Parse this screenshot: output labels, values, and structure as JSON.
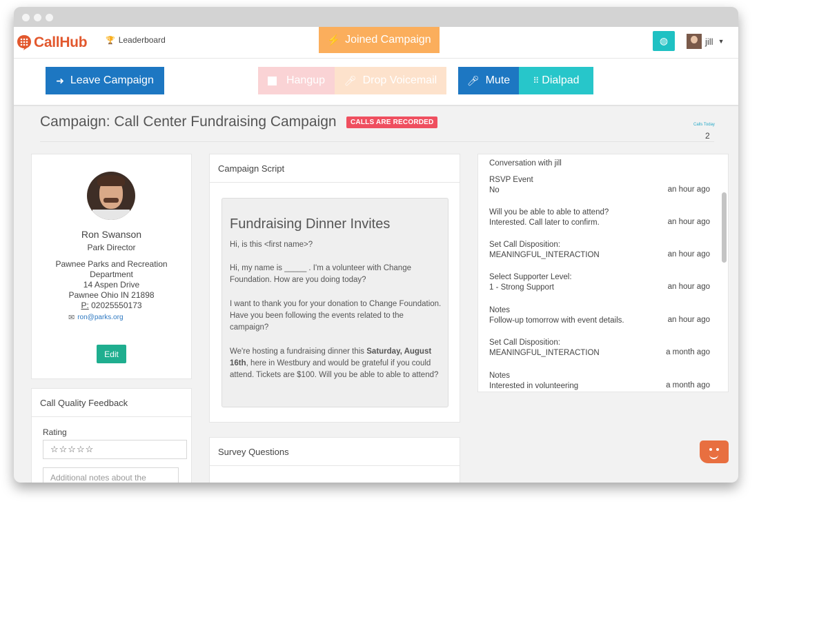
{
  "navbar": {
    "brand": "CallHub",
    "leaderboard": "Leaderboard",
    "joined_campaign": "Joined Campaign",
    "user_name": "jill"
  },
  "toolbar": {
    "leave_campaign": "Leave Campaign",
    "hangup": "Hangup",
    "drop_voicemail": "Drop Voicemail",
    "mute": "Mute",
    "dialpad": "Dialpad"
  },
  "header": {
    "title": "Campaign: Call Center Fundraising Campaign",
    "recorded_badge": "CALLS ARE RECORDED",
    "calls_today_label": "Calls Today",
    "calls_today_value": "2"
  },
  "contact": {
    "name": "Ron Swanson",
    "title": "Park Director",
    "org_line1": "Pawnee Parks and Recreation",
    "org_line2": "Department",
    "street": "14 Aspen Drive",
    "city": "Pawnee Ohio IN 21898",
    "phone_prefix": "P:",
    "phone": "02025550173",
    "email": "ron@parks.org",
    "edit_label": "Edit"
  },
  "feedback": {
    "title": "Call Quality Feedback",
    "rating_label": "Rating",
    "stars": "☆☆☆☆☆",
    "notes_placeholder": "Additional notes about the"
  },
  "script": {
    "panel_title": "Campaign Script",
    "title": "Fundraising Dinner Invites",
    "p1": "Hi, is this <first name>?",
    "p2": "Hi, my name is _____ . I'm a volunteer with Change Foundation. How are you doing today?",
    "p3": "I want to thank you for your donation to Change Foundation. Have you been following the events related to the campaign?",
    "p4_a": "We're hosting a fundraising dinner this ",
    "p4_bold": "Saturday, August 16th",
    "p4_b": ", here in Westbury and would be grateful if you could attend. Tickets are $100. Will you be able to able to attend?"
  },
  "survey": {
    "title": "Survey Questions"
  },
  "conversation": {
    "title": "Conversation with jill",
    "items": [
      {
        "label": "RSVP Event",
        "value": "No",
        "time": "an hour ago"
      },
      {
        "label": "Will you be able to able to attend?",
        "value": "Interested. Call later to confirm.",
        "time": "an hour ago"
      },
      {
        "label": "Set Call Disposition:",
        "value": "MEANINGFUL_INTERACTION",
        "time": "an hour ago"
      },
      {
        "label": "Select Supporter Level:",
        "value": "1 - Strong Support",
        "time": "an hour ago"
      },
      {
        "label": "Notes",
        "value": "Follow-up tomorrow with event details.",
        "time": "an hour ago"
      },
      {
        "label": "Set Call Disposition:",
        "value": "MEANINGFUL_INTERACTION",
        "time": "a month ago"
      },
      {
        "label": "Notes",
        "value": "Interested in volunteering",
        "time": "a month ago"
      }
    ]
  },
  "colors": {
    "brand": "#e2582e",
    "primary": "#1d77c2",
    "teal": "#27c6ca",
    "orange": "#fbae5c",
    "danger": "#ef4f5f",
    "success": "#1fae8f"
  }
}
